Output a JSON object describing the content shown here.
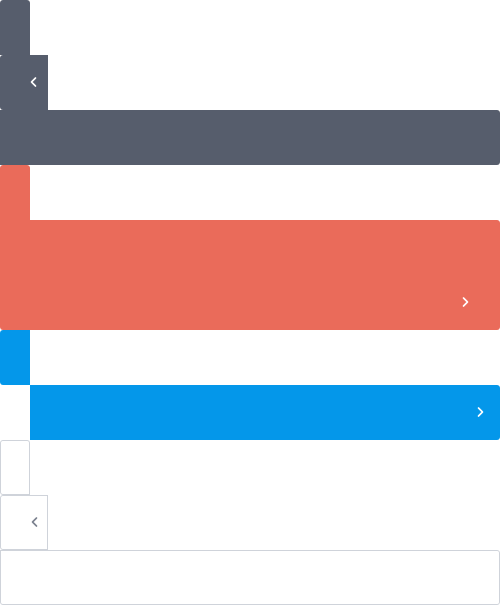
{
  "colors": {
    "dark": "#565D6C",
    "red": "#EA6B5A",
    "blue": "#0497EA",
    "outline_border": "#CFD3DA",
    "chevron_dark": "#7A818E"
  },
  "icons": {
    "dark_prev": "chevron-left-icon",
    "red_next": "chevron-right-icon",
    "blue_next": "chevron-right-icon",
    "outline_prev": "chevron-left-icon"
  }
}
